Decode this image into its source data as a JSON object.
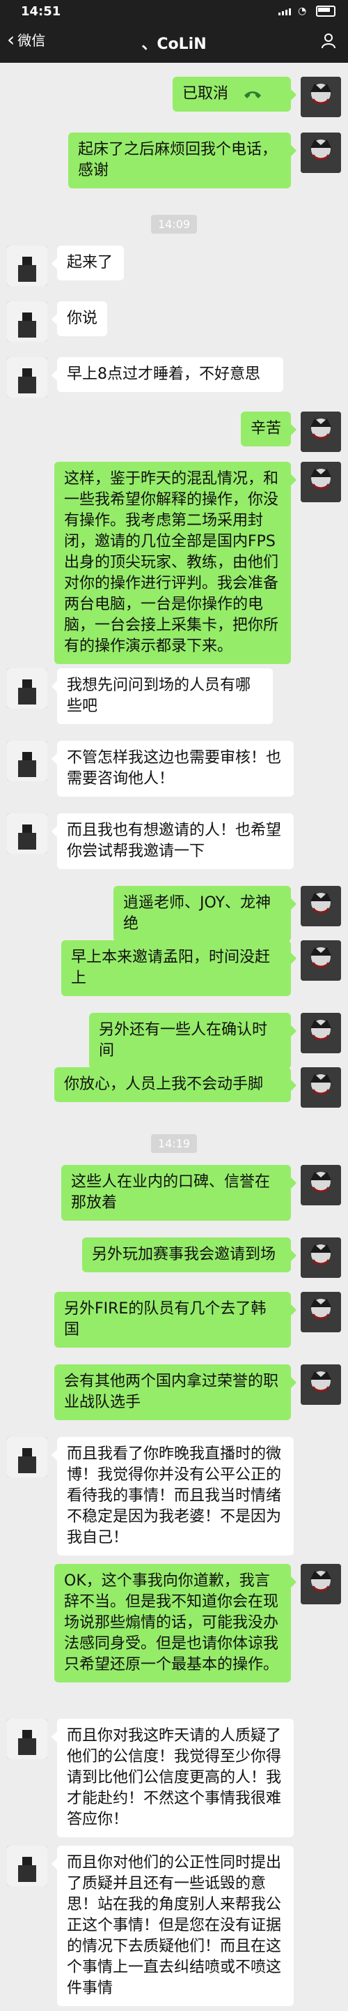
{
  "status": {
    "time": "14:51"
  },
  "nav": {
    "back_label": "微信",
    "title": "、CoLiN"
  },
  "timestamps": [
    "14:09",
    "14:19"
  ],
  "messages": [
    {
      "side": "right",
      "text": "已取消"
    },
    {
      "side": "right",
      "text": "起床了之后麻烦回我个电话，感谢"
    },
    {
      "side": "left",
      "text": "起来了"
    },
    {
      "side": "left",
      "text": "你说"
    },
    {
      "side": "left",
      "text": "早上8点过才睡着，不好意思"
    },
    {
      "side": "right",
      "text": "辛苦"
    },
    {
      "side": "right",
      "text": "这样，鉴于昨天的混乱情况，和一些我希望你解释的操作，你没有操作。我考虑第二场采用封闭，邀请的几位全部是国内FPS出身的顶尖玩家、教练，由他们对你的操作进行评判。我会准备两台电脑，一台是你操作的电脑，一台会接上采集卡，把你所有的操作演示都录下来。"
    },
    {
      "side": "left",
      "text": "我想先问问到场的人员有哪些吧"
    },
    {
      "side": "left",
      "text": "不管怎样我这边也需要审核！也需要咨询他人！"
    },
    {
      "side": "left",
      "text": "而且我也有想邀请的人！也希望你尝试帮我邀请一下"
    },
    {
      "side": "right",
      "text": "逍遥老师、JOY、龙神绝"
    },
    {
      "side": "right",
      "text": "早上本来邀请孟阳，时间没赶上"
    },
    {
      "side": "right",
      "text": "另外还有一些人在确认时间"
    },
    {
      "side": "right",
      "text": "你放心，人员上我不会动手脚"
    },
    {
      "side": "right",
      "text": "这些人在业内的口碑、信誉在那放着"
    },
    {
      "side": "right",
      "text": "另外玩加赛事我会邀请到场"
    },
    {
      "side": "right",
      "text": "另外FIRE的队员有几个去了韩国"
    },
    {
      "side": "right",
      "text": "会有其他两个国内拿过荣誉的职业战队选手"
    },
    {
      "side": "left",
      "text": "而且我看了你昨晚我直播时的微博！我觉得你并没有公平公正的看待我的事情！而且我当时情绪不稳定是因为我老婆！不是因为我自己！"
    },
    {
      "side": "right",
      "text": "OK，这个事我向你道歉，我言辞不当。但是我不知道你会在现场说那些煽情的话，可能我没办法感同身受。但是也请你体谅我只希望还原一个最基本的操作。"
    },
    {
      "side": "left",
      "text": "而且你对我这昨天请的人质疑了他们的公信度！我觉得至少你得请到比他们公信度更高的人！我才能赴约！不然这个事情我很难答应你！"
    },
    {
      "side": "left",
      "text": "而且你对他们的公正性同时提出了质疑并且还有一些诋毁的意思！站在我的角度别人来帮我公正这个事情！但是您在没有证据的情况下去质疑他们！而且在这个事情上一直去纠结喷或不喷这件事情"
    }
  ],
  "colors": {
    "bubble_right": "#95ec69",
    "bubble_left": "#ffffff",
    "background": "#ededed",
    "bar": "#1f1f1f"
  }
}
